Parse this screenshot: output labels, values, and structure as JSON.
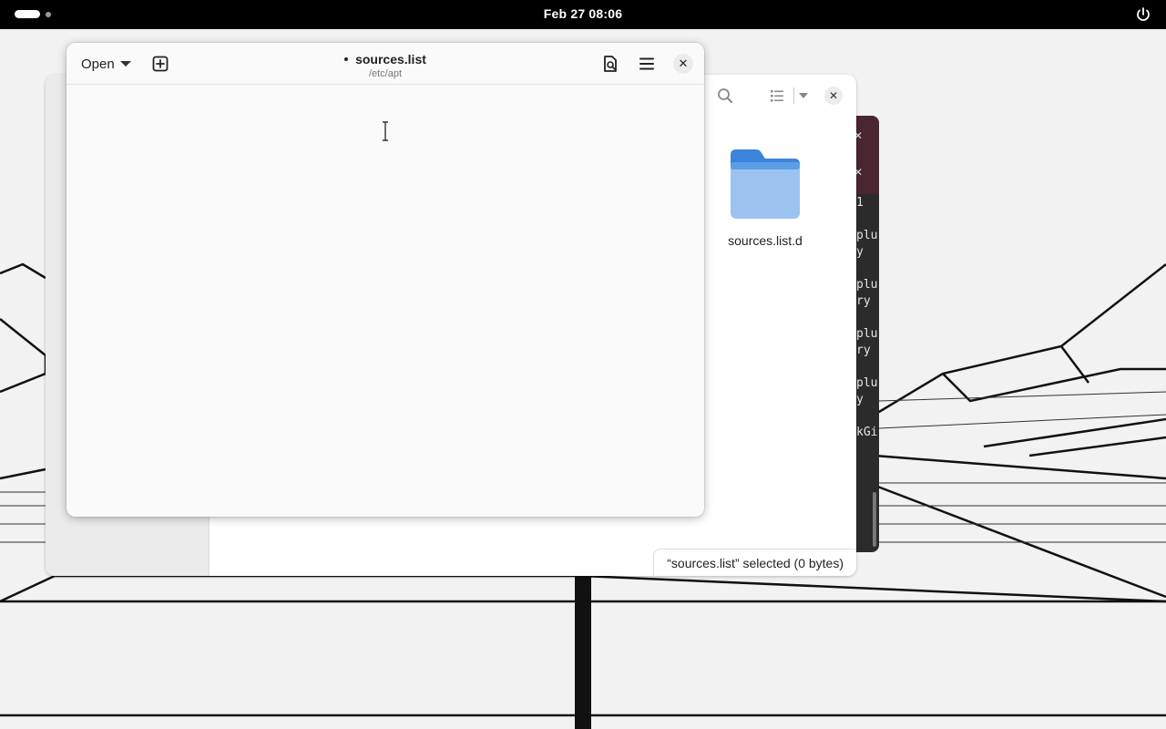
{
  "topbar": {
    "clock": "Feb 27  08:06",
    "icons": {
      "power": "power-icon"
    }
  },
  "editor": {
    "open_label": "Open",
    "title": "sources.list",
    "path": "/etc/apt",
    "modified": true,
    "icons": {
      "open_caret": "chevron-down-icon",
      "new_tab": "new-tab-icon",
      "document_search": "document-search-icon",
      "menu": "hamburger-menu-icon",
      "close": "close-icon"
    },
    "close_glyph": "✕",
    "content": ""
  },
  "files": {
    "items": [
      {
        "label": "sources.list.d",
        "type": "folder"
      }
    ],
    "status": "“sources.list” selected  (0 bytes)",
    "close_glyph": "✕",
    "icons": {
      "search": "search-icon",
      "view_list": "list-view-icon",
      "view_dropdown": "chevron-down-icon",
      "folder": "folder-icon"
    }
  },
  "terminal": {
    "close_glyph": "✕",
    "lines": [
      "1",
      "plu",
      "y",
      "",
      "",
      "plu",
      "ry",
      "",
      "",
      "plu",
      "ry",
      "",
      "",
      "plu",
      "y",
      "",
      "",
      "kGi"
    ]
  },
  "colors": {
    "accent_folder": "#5a9ee6",
    "topbar_bg": "#000000",
    "terminal_tab": "#4a2630"
  }
}
